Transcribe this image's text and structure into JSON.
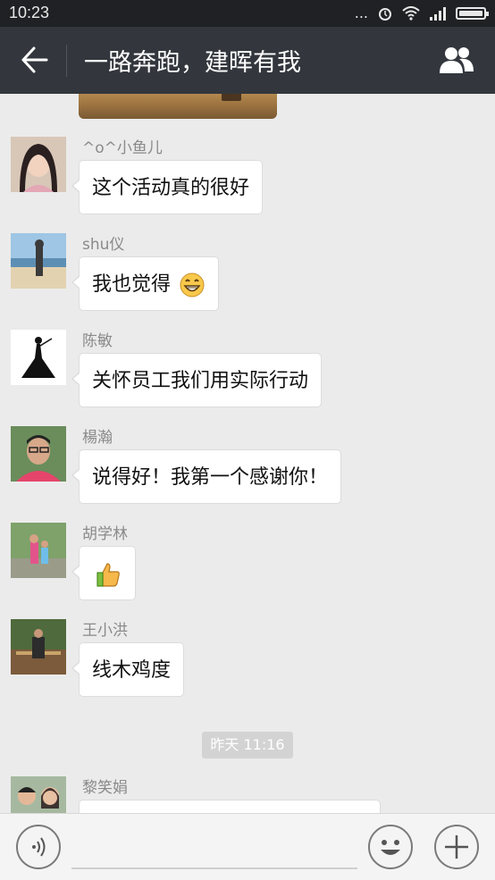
{
  "status_bar": {
    "time": "10:23",
    "dots": "..."
  },
  "header": {
    "title": "一路奔跑，建晖有我"
  },
  "messages": [
    {
      "name": "^o^小鱼儿",
      "text": "这个活动真的很好",
      "avatar": "avatar-girl"
    },
    {
      "name": "shu仪",
      "text": "我也觉得",
      "emoji": "grinning-face-emoji",
      "avatar": "avatar-beach"
    },
    {
      "name": "陈敏",
      "text": "关怀员工我们用实际行动",
      "avatar": "avatar-silhouette"
    },
    {
      "name": "楊瀚",
      "text": "说得好！我第一个感谢你！",
      "avatar": "avatar-man"
    },
    {
      "name": "胡学林",
      "text": "",
      "emoji": "thumbs-up-emoji",
      "avatar": "avatar-kids"
    },
    {
      "name": "王小洪",
      "text": "线木鸡度",
      "avatar": "avatar-outdoor"
    },
    {
      "name": "黎笑娟",
      "text": "",
      "avatar": "avatar-family"
    }
  ],
  "timestamp": "昨天 11:16",
  "colors": {
    "header": "#33373d",
    "statusbar": "#1f2124",
    "background": "#ebebeb"
  }
}
